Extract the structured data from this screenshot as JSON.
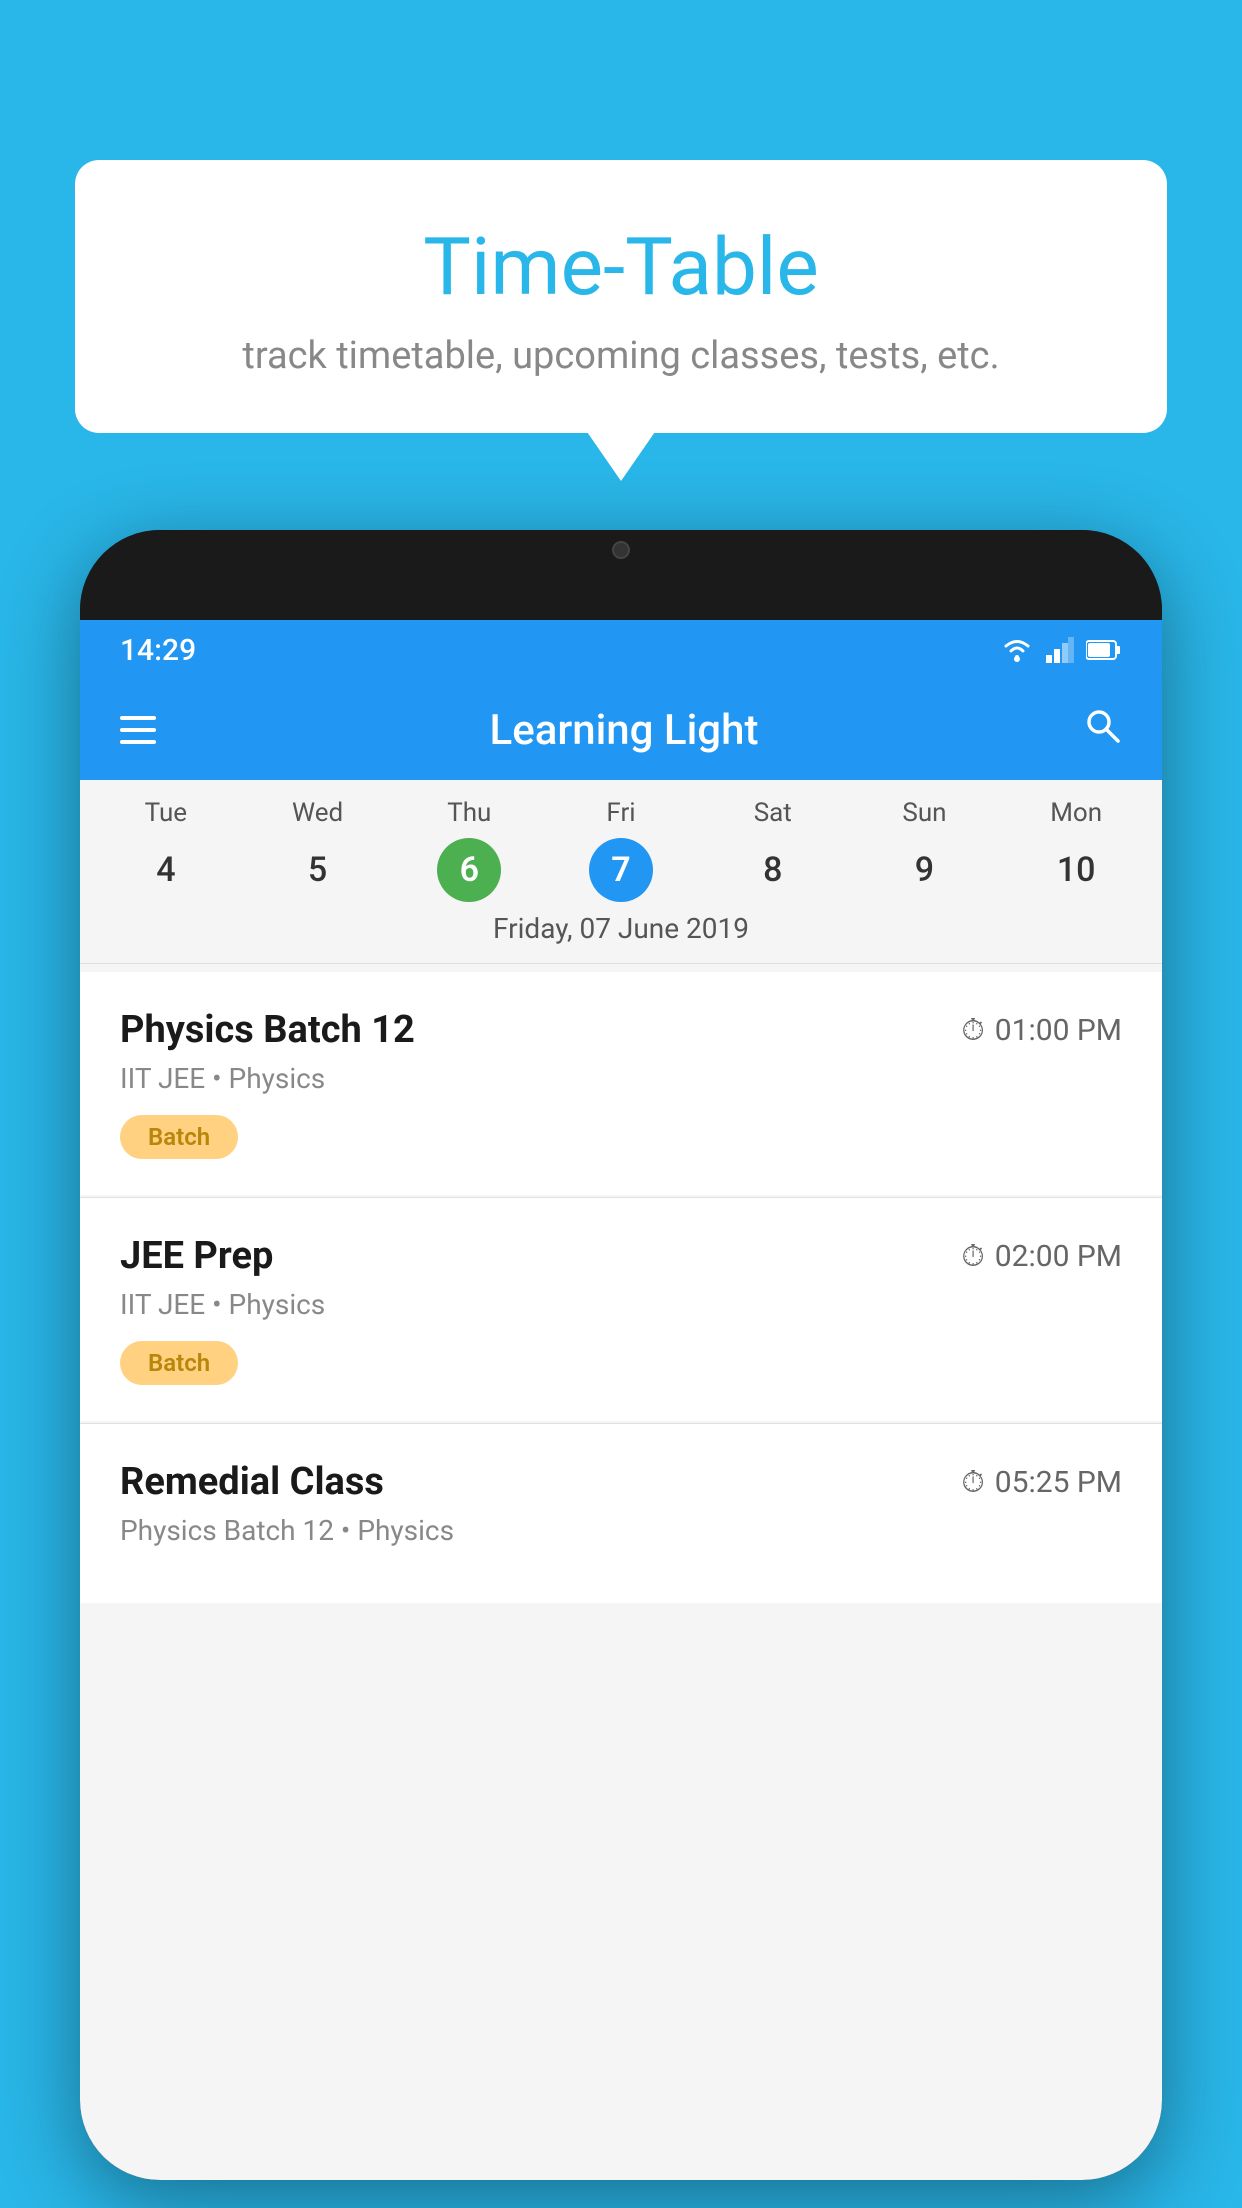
{
  "background_color": "#29b6e8",
  "speech_bubble": {
    "title": "Time-Table",
    "subtitle": "track timetable, upcoming classes, tests, etc."
  },
  "app": {
    "name": "Learning Light",
    "status_bar": {
      "time": "14:29"
    }
  },
  "calendar": {
    "days": [
      {
        "name": "Tue",
        "num": "4",
        "state": "normal"
      },
      {
        "name": "Wed",
        "num": "5",
        "state": "normal"
      },
      {
        "name": "Thu",
        "num": "6",
        "state": "today"
      },
      {
        "name": "Fri",
        "num": "7",
        "state": "selected"
      },
      {
        "name": "Sat",
        "num": "8",
        "state": "normal"
      },
      {
        "name": "Sun",
        "num": "9",
        "state": "normal"
      },
      {
        "name": "Mon",
        "num": "10",
        "state": "normal"
      }
    ],
    "selected_date_label": "Friday, 07 June 2019"
  },
  "classes": [
    {
      "title": "Physics Batch 12",
      "time": "01:00 PM",
      "subtitle": "IIT JEE • Physics",
      "badge": "Batch"
    },
    {
      "title": "JEE Prep",
      "time": "02:00 PM",
      "subtitle": "IIT JEE • Physics",
      "badge": "Batch"
    },
    {
      "title": "Remedial Class",
      "time": "05:25 PM",
      "subtitle": "Physics Batch 12 • Physics",
      "badge": ""
    }
  ]
}
